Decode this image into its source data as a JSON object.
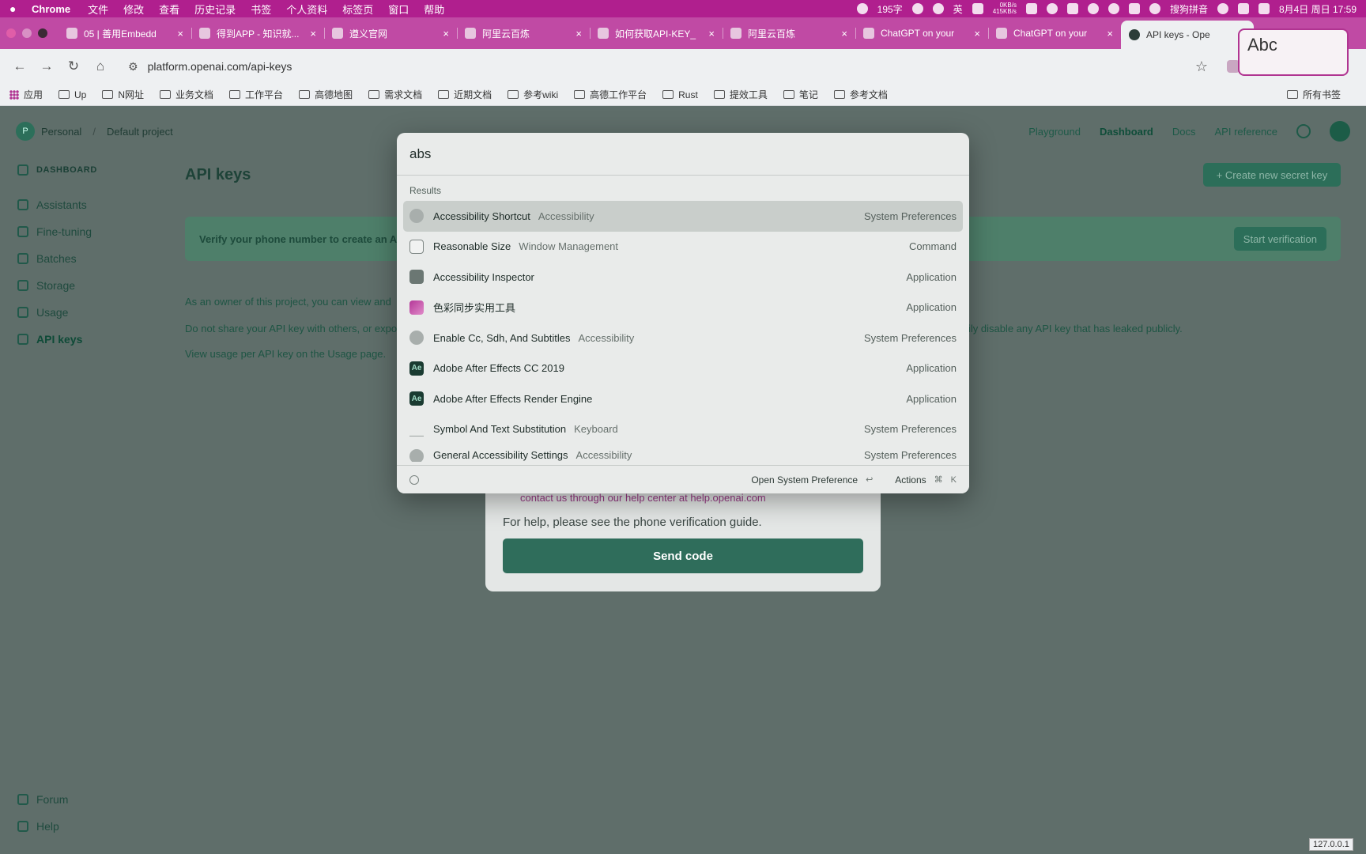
{
  "menubar": {
    "app": "Chrome",
    "items": [
      "文件",
      "修改",
      "查看",
      "历史记录",
      "书签",
      "个人资料",
      "标签页",
      "窗口",
      "帮助"
    ],
    "word_count": "195字",
    "input_method_short": "英",
    "net_up": "0KB/s",
    "net_down": "415KB/s",
    "ime": "搜狗拼音",
    "datetime": "8月4日 周日  17:59"
  },
  "tabs": [
    {
      "title": "05 | 善用Embedd",
      "active": false
    },
    {
      "title": "得到APP - 知识就...",
      "active": false
    },
    {
      "title": "遵义官网",
      "active": false
    },
    {
      "title": "阿里云百炼",
      "active": false
    },
    {
      "title": "如何获取API-KEY_",
      "active": false
    },
    {
      "title": "阿里云百炼",
      "active": false
    },
    {
      "title": "ChatGPT on your",
      "active": false
    },
    {
      "title": "ChatGPT on your",
      "active": false
    },
    {
      "title": "API keys - Ope",
      "active": true
    }
  ],
  "address": {
    "url": "platform.openai.com/api-keys"
  },
  "bookmarks": {
    "apps": "应用",
    "folders": [
      "Up",
      "N网址",
      "业务文档",
      "工作平台",
      "高德地图",
      "需求文档",
      "近期文档",
      "参考wiki",
      "高德工作平台",
      "Rust",
      "提效工具",
      "笔记",
      "参考文档"
    ],
    "all": "所有书签"
  },
  "page": {
    "org": "Personal",
    "org_initial": "P",
    "project": "Default project",
    "nav": {
      "playground": "Playground",
      "dashboard": "Dashboard",
      "docs": "Docs",
      "api_reference": "API reference"
    },
    "sidebar": {
      "heading": "DASHBOARD",
      "items": [
        "Assistants",
        "Fine-tuning",
        "Batches",
        "Storage",
        "Usage",
        "API keys"
      ],
      "bottom": [
        "Forum",
        "Help"
      ]
    },
    "title": "API keys",
    "create_button": "+ Create new secret key",
    "banner_text": "Verify your phone number to create an A",
    "start_verification": "Start verification",
    "para1": "As an owner of this project, you can view and",
    "para2": "Do not share your API key with others, or expo",
    "para2_tail": "ily disable any API key that has leaked publicly.",
    "para3": "View usage per API key on the Usage page."
  },
  "verify_modal": {
    "contact": "contact us through our help center at help.openai.com",
    "help": "For help, please see the phone verification guide.",
    "send_code": "Send code"
  },
  "launcher": {
    "query": "abs",
    "results_heading": "Results",
    "results": [
      {
        "name": "Accessibility Shortcut",
        "sub": "Accessibility",
        "type": "System Preferences",
        "icon": "accessibility-icon"
      },
      {
        "name": "Reasonable Size",
        "sub": "Window Management",
        "type": "Command",
        "icon": "window-icon"
      },
      {
        "name": "Accessibility Inspector",
        "sub": "",
        "type": "Application",
        "icon": "inspector-icon"
      },
      {
        "name": "色彩同步实用工具",
        "sub": "",
        "type": "Application",
        "icon": "colorsync-icon"
      },
      {
        "name": "Enable Cc, Sdh, And Subtitles",
        "sub": "Accessibility",
        "type": "System Preferences",
        "icon": "accessibility-icon"
      },
      {
        "name": "Adobe After Effects CC 2019",
        "sub": "",
        "type": "Application",
        "icon": "ae-icon"
      },
      {
        "name": "Adobe After Effects Render Engine",
        "sub": "",
        "type": "Application",
        "icon": "ae-icon"
      },
      {
        "name": "Symbol And Text Substitution",
        "sub": "Keyboard",
        "type": "System Preferences",
        "icon": "keyboard-icon"
      },
      {
        "name": "General Accessibility Settings",
        "sub": "Accessibility",
        "type": "System Preferences",
        "icon": "accessibility-icon"
      }
    ],
    "footer_primary": "Open System Preference",
    "footer_return": "↩",
    "footer_actions": "Actions",
    "footer_shortcut_cmd": "⌘",
    "footer_shortcut_key": "K"
  },
  "float_widget": {
    "text": "Abc"
  },
  "ip_badge": "127.0.0.1"
}
